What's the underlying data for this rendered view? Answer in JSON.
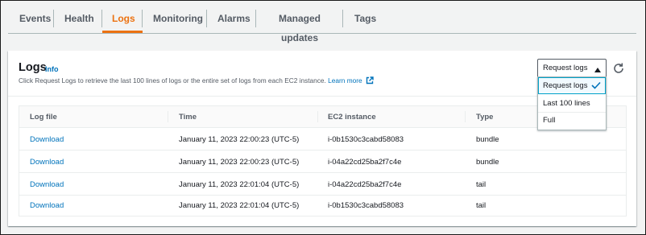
{
  "tabs": [
    {
      "label": "Events"
    },
    {
      "label": "Health"
    },
    {
      "label": "Logs"
    },
    {
      "label": "Monitoring"
    },
    {
      "label": "Alarms"
    },
    {
      "label": "Managed updates"
    },
    {
      "label": "Tags"
    }
  ],
  "active_tab": "Logs",
  "panel": {
    "title": "Logs",
    "info": "Info",
    "description": "Click Request Logs to retrieve the last 100 lines of logs or the entire set of logs from each EC2 instance.",
    "learn_more": "Learn more",
    "request_button": "Request logs",
    "refresh_icon": "refresh-icon"
  },
  "dropdown": {
    "options": [
      {
        "label": "Request logs",
        "selected": true
      },
      {
        "label": "Last 100 lines",
        "selected": false
      },
      {
        "label": "Full",
        "selected": false
      }
    ]
  },
  "table": {
    "headers": [
      "Log file",
      "Time",
      "EC2 instance",
      "Type"
    ],
    "rows": [
      {
        "log_file": "Download",
        "time": "January 11, 2023 22:00:23 (UTC-5)",
        "instance": "i-0b1530c3cabd58083",
        "type": "bundle"
      },
      {
        "log_file": "Download",
        "time": "January 11, 2023 22:00:23 (UTC-5)",
        "instance": "i-04a22cd25ba2f7c4e",
        "type": "bundle"
      },
      {
        "log_file": "Download",
        "time": "January 11, 2023 22:01:04 (UTC-5)",
        "instance": "i-04a22cd25ba2f7c4e",
        "type": "tail"
      },
      {
        "log_file": "Download",
        "time": "January 11, 2023 22:01:04 (UTC-5)",
        "instance": "i-0b1530c3cabd58083",
        "type": "tail"
      }
    ]
  },
  "colors": {
    "accent_tab": "#ec7211",
    "link": "#0073bb",
    "selected_bg": "#f1faff",
    "selected_border": "#00a1c9"
  }
}
